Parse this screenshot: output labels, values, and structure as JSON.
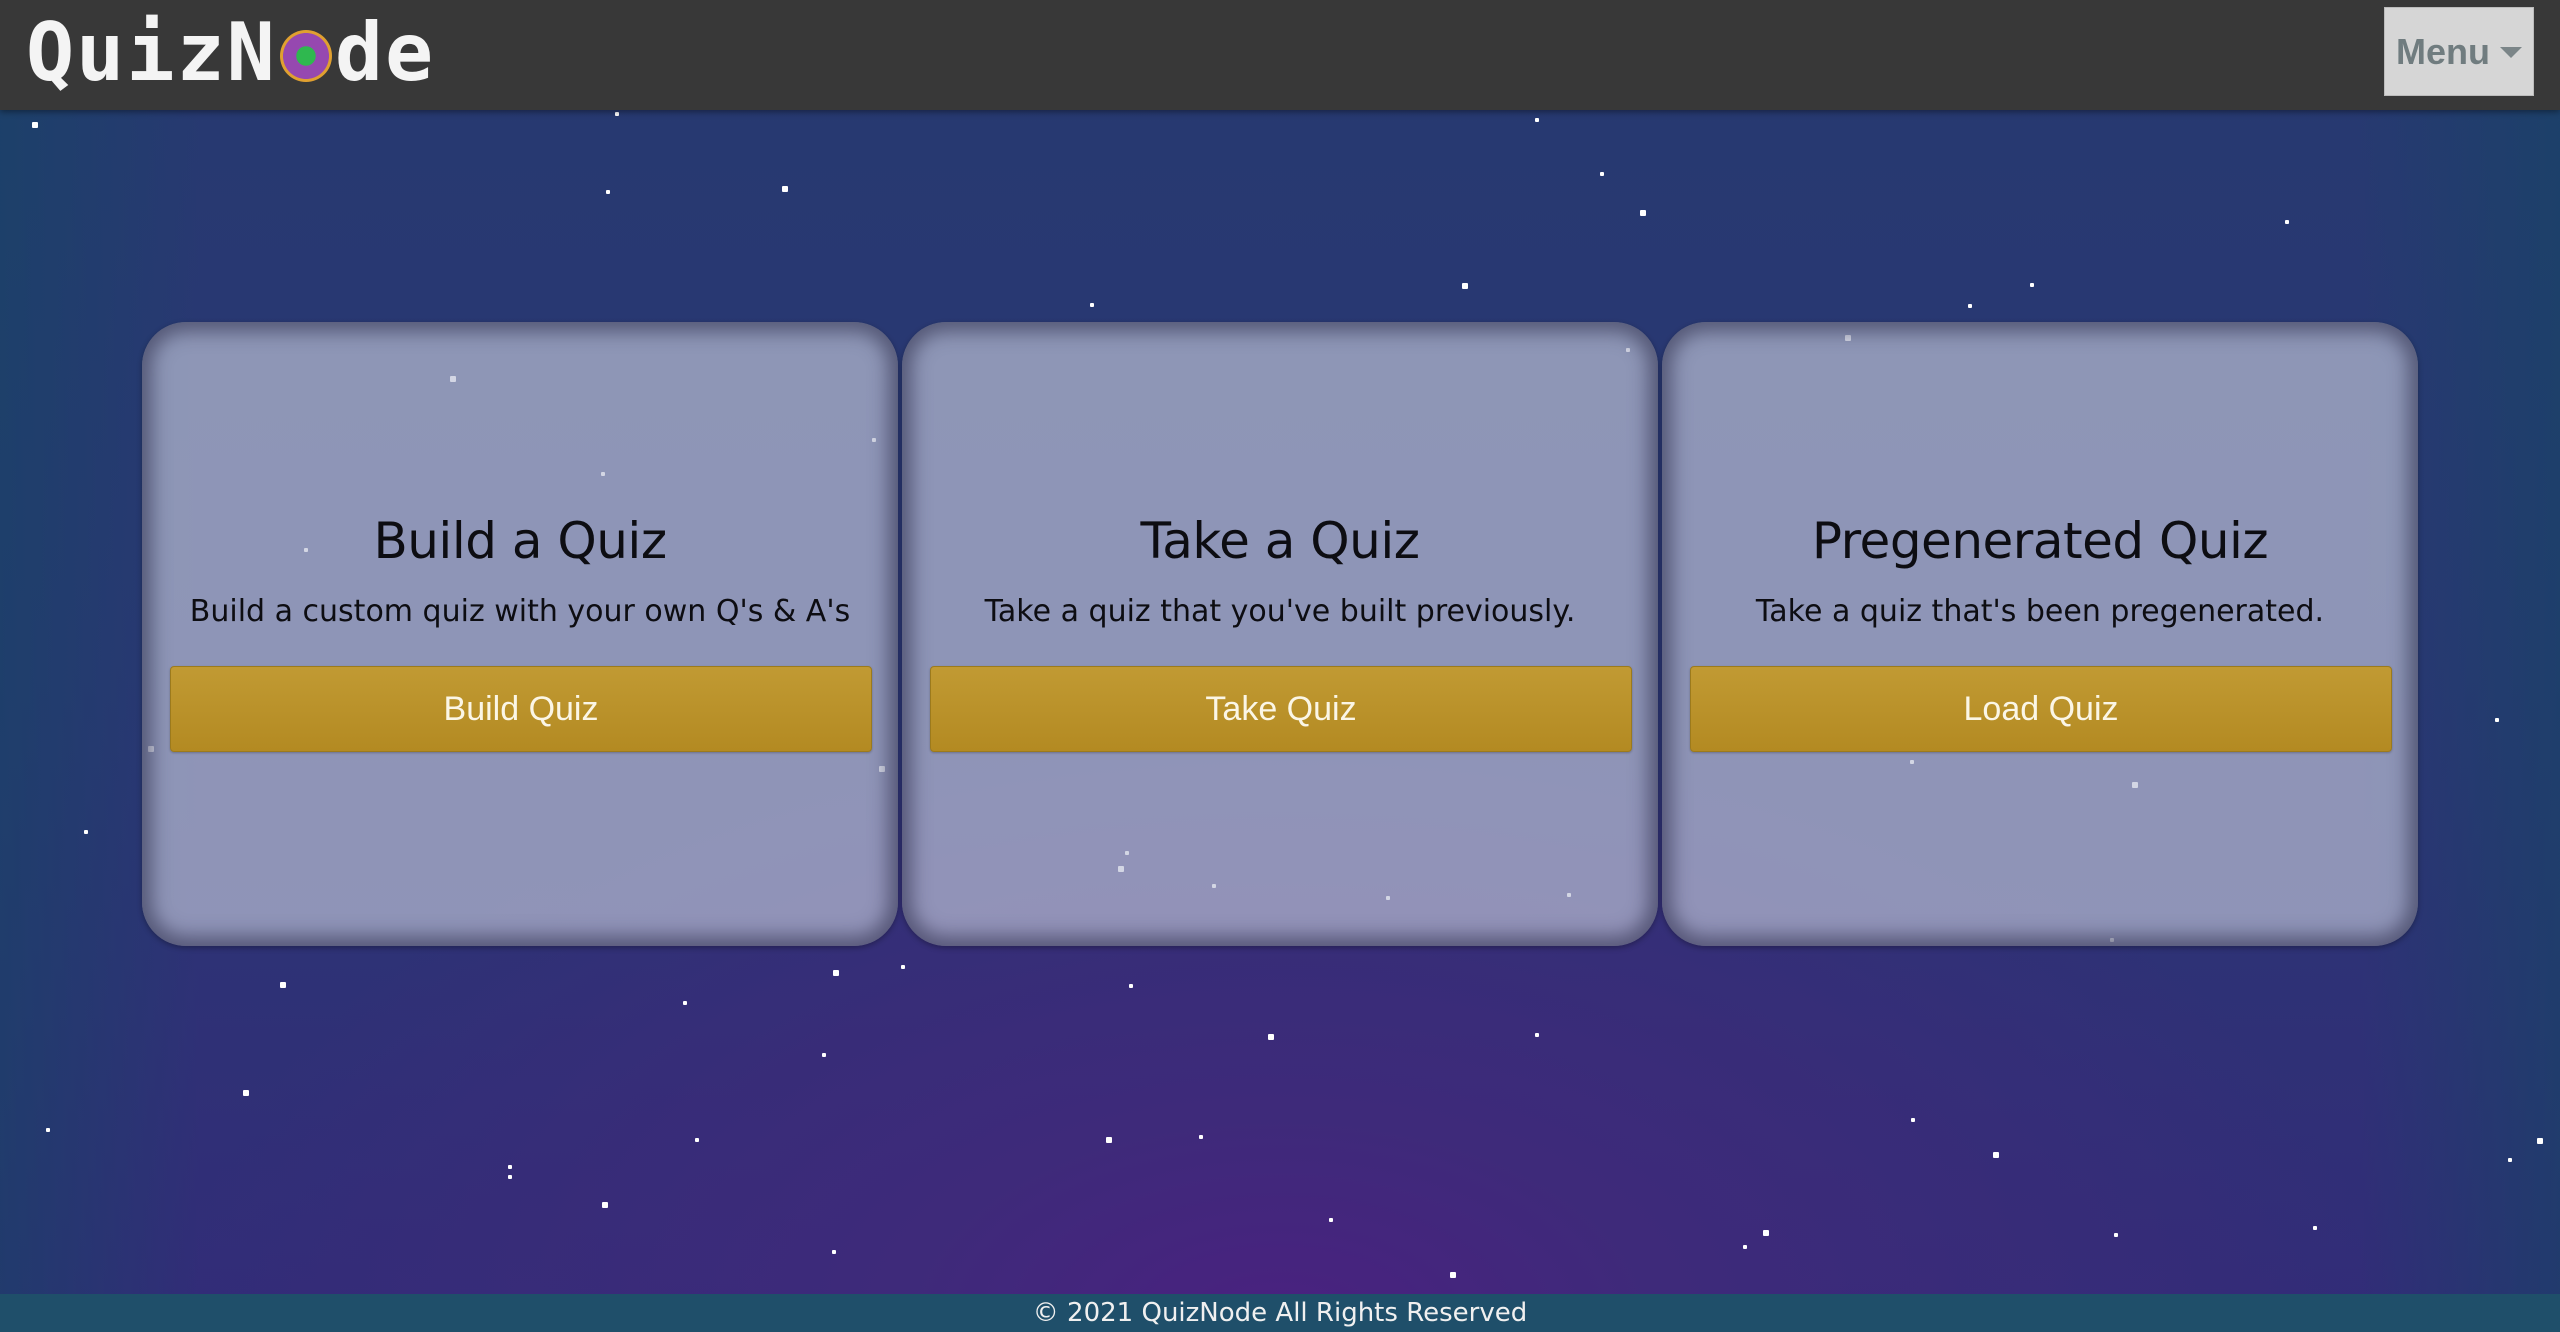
{
  "navbar": {
    "brand_prefix": "QuizN",
    "brand_suffix": "de",
    "menu_label": "Menu"
  },
  "cards": [
    {
      "title": "Build a Quiz",
      "description": "Build a custom quiz with your own Q's & A's",
      "button_label": "Build Quiz"
    },
    {
      "title": "Take a Quiz",
      "description": "Take a quiz that you've built previously.",
      "button_label": "Take Quiz"
    },
    {
      "title": "Pregenerated Quiz",
      "description": "Take a quiz that's been pregenerated.",
      "button_label": "Load Quiz"
    }
  ],
  "footer": {
    "text": "© 2021 QuizNode All Rights Reserved"
  },
  "colors": {
    "navbar": "#383838",
    "button": "#b8912a",
    "footer": "#1f4f6a"
  }
}
